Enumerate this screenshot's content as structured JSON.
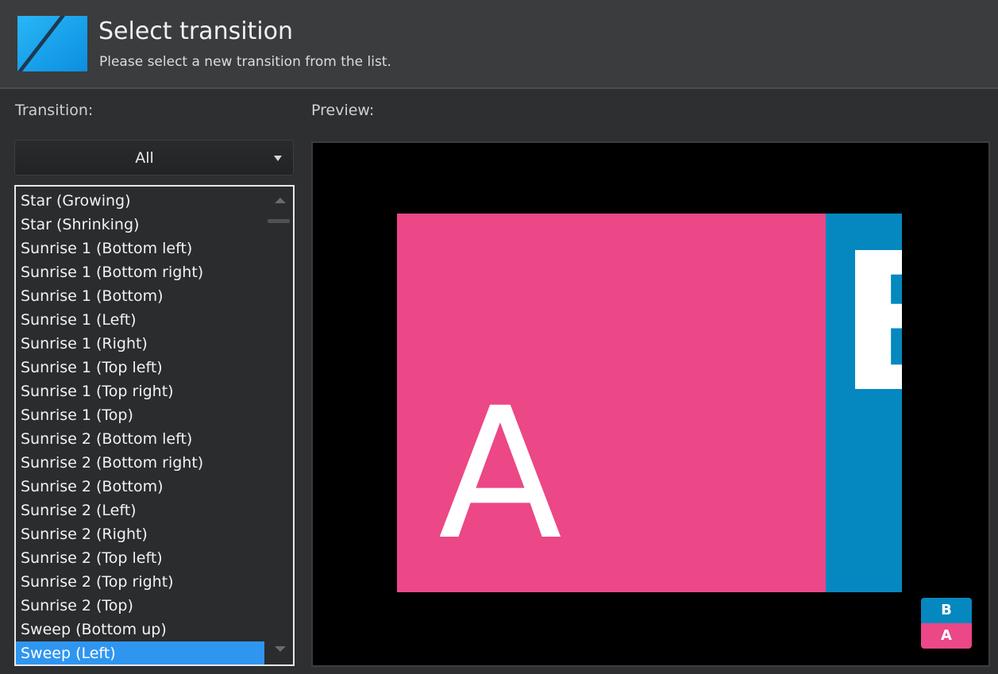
{
  "header": {
    "title": "Select transition",
    "subtitle": "Please select a new transition from the list.",
    "logo_icon": "diagonal-slash-logo-icon",
    "logo_color": "#1fa4ee"
  },
  "labels": {
    "transition": "Transition:",
    "preview": "Preview:"
  },
  "category_dropdown": {
    "selected": "All"
  },
  "transition_list": {
    "items": [
      "Star (Growing)",
      "Star (Shrinking)",
      "Sunrise 1 (Bottom left)",
      "Sunrise 1 (Bottom right)",
      "Sunrise 1 (Bottom)",
      "Sunrise 1 (Left)",
      "Sunrise 1 (Right)",
      "Sunrise 1 (Top left)",
      "Sunrise 1 (Top right)",
      "Sunrise 1 (Top)",
      "Sunrise 2 (Bottom left)",
      "Sunrise 2 (Bottom right)",
      "Sunrise 2 (Bottom)",
      "Sunrise 2 (Left)",
      "Sunrise 2 (Right)",
      "Sunrise 2 (Top left)",
      "Sunrise 2 (Top right)",
      "Sunrise 2 (Top)",
      "Sweep (Bottom up)",
      "Sweep (Left)"
    ],
    "selected_index": 19
  },
  "preview": {
    "slide_a_letter": "A",
    "slide_b_letter": "B",
    "slide_a_color": "#ec4787",
    "slide_b_color": "#0588bf",
    "legend_top": "B",
    "legend_bottom": "A"
  },
  "colors": {
    "background": "#2e2f31",
    "header": "#3b3c3e",
    "selection": "#2f96f0"
  }
}
